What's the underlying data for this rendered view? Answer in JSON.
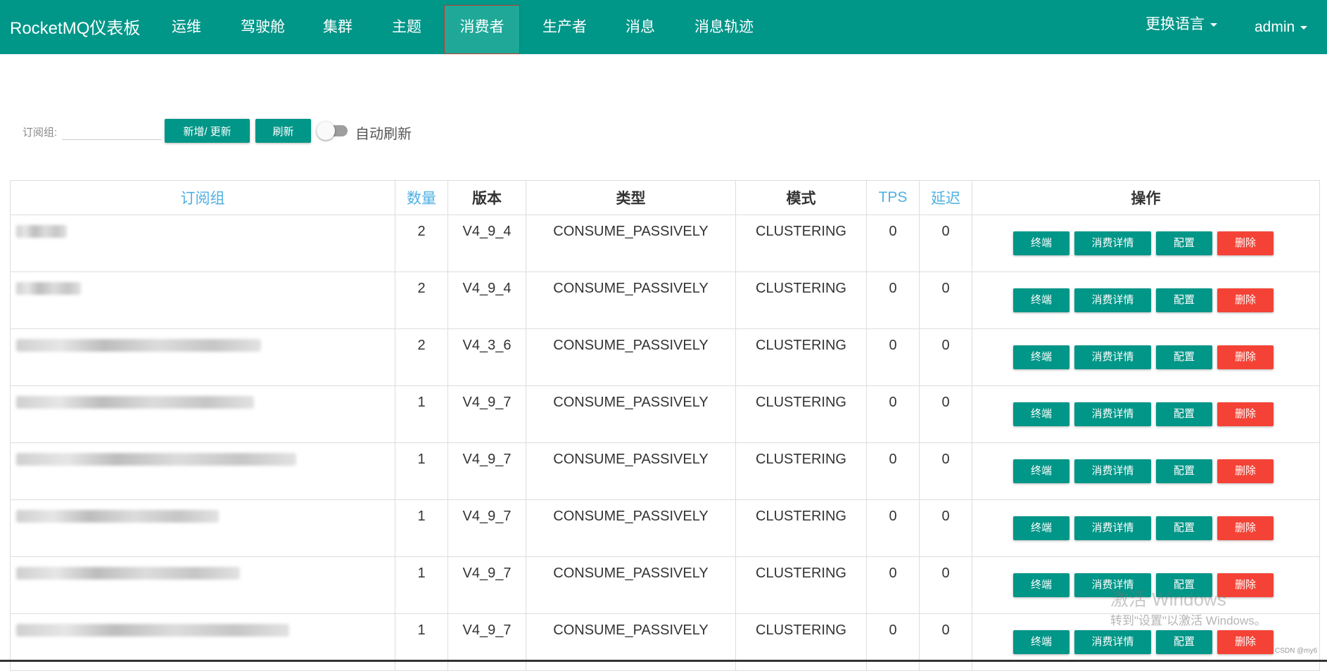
{
  "brand": "RocketMQ仪表板",
  "nav": {
    "items": [
      {
        "label": "运维"
      },
      {
        "label": "驾驶舱"
      },
      {
        "label": "集群"
      },
      {
        "label": "主题"
      },
      {
        "label": "消费者",
        "active": true
      },
      {
        "label": "生产者"
      },
      {
        "label": "消息"
      },
      {
        "label": "消息轨迹"
      }
    ],
    "language": "更换语言",
    "user": "admin"
  },
  "toolbar": {
    "filter_label": "订阅组:",
    "filter_value": "",
    "add_update_label": "新增/ 更新",
    "refresh_label": "刷新",
    "auto_refresh_label": "自动刷新",
    "auto_refresh_on": false
  },
  "table": {
    "columns": [
      "订阅组",
      "数量",
      "版本",
      "类型",
      "模式",
      "TPS",
      "延迟",
      "操作"
    ],
    "actions": {
      "client": "终端",
      "detail": "消费详情",
      "config": "配置",
      "delete": "删除"
    },
    "rows": [
      {
        "group": "",
        "count": "2",
        "version": "V4_9_4",
        "type": "CONSUME_PASSIVELY",
        "mode": "CLUSTERING",
        "tps": "0",
        "delay": "0"
      },
      {
        "group": "",
        "count": "2",
        "version": "V4_9_4",
        "type": "CONSUME_PASSIVELY",
        "mode": "CLUSTERING",
        "tps": "0",
        "delay": "0"
      },
      {
        "group": "",
        "count": "2",
        "version": "V4_3_6",
        "type": "CONSUME_PASSIVELY",
        "mode": "CLUSTERING",
        "tps": "0",
        "delay": "0"
      },
      {
        "group": "",
        "count": "1",
        "version": "V4_9_7",
        "type": "CONSUME_PASSIVELY",
        "mode": "CLUSTERING",
        "tps": "0",
        "delay": "0"
      },
      {
        "group": "",
        "count": "1",
        "version": "V4_9_7",
        "type": "CONSUME_PASSIVELY",
        "mode": "CLUSTERING",
        "tps": "0",
        "delay": "0"
      },
      {
        "group": "",
        "count": "1",
        "version": "V4_9_7",
        "type": "CONSUME_PASSIVELY",
        "mode": "CLUSTERING",
        "tps": "0",
        "delay": "0"
      },
      {
        "group": "",
        "count": "1",
        "version": "V4_9_7",
        "type": "CONSUME_PASSIVELY",
        "mode": "CLUSTERING",
        "tps": "0",
        "delay": "0"
      },
      {
        "group": "",
        "count": "1",
        "version": "V4_9_7",
        "type": "CONSUME_PASSIVELY",
        "mode": "CLUSTERING",
        "tps": "0",
        "delay": "0"
      }
    ]
  },
  "watermark": {
    "line1": "激活 Windows",
    "line2": "转到\"设置\"以激活 Windows。",
    "credit": "CSDN @my6"
  },
  "colors": {
    "primary": "#009688",
    "danger": "#f44336",
    "sortable_header": "#4fb0e2",
    "active_tab_border": "#c0392b"
  }
}
